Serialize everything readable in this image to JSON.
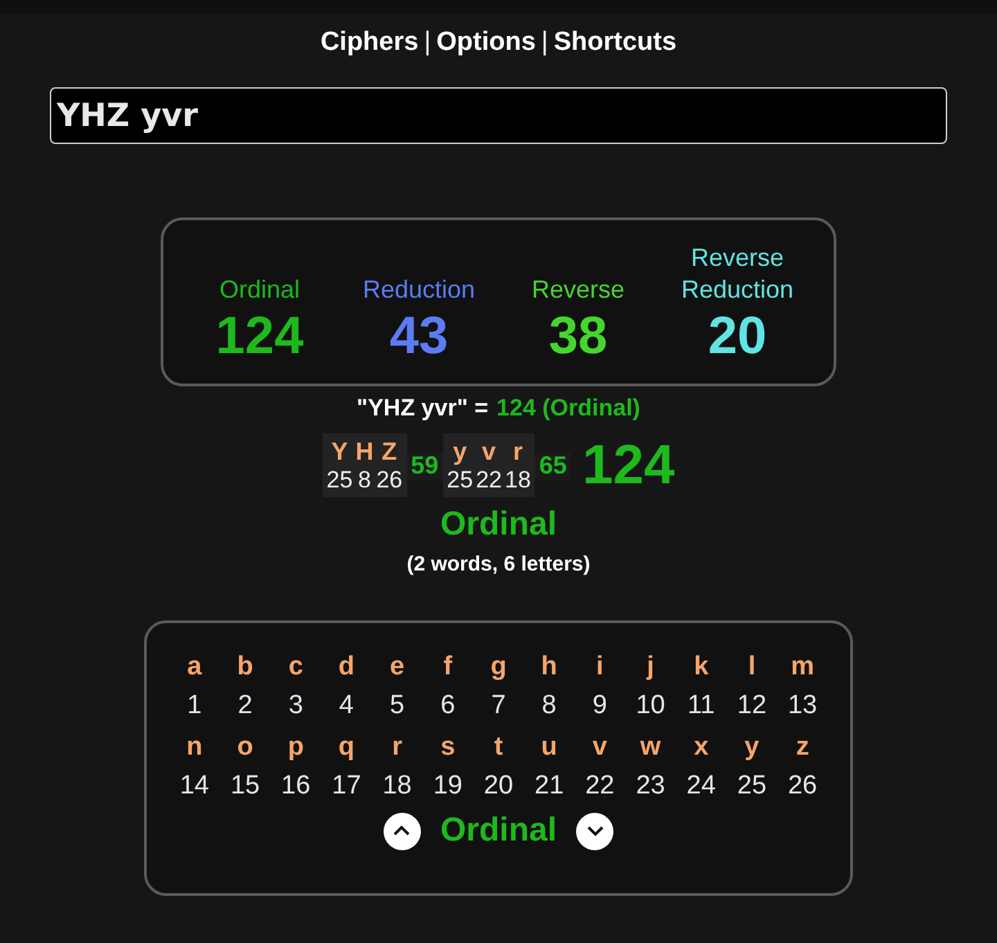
{
  "nav": {
    "links": [
      "Ciphers",
      "Options",
      "Shortcuts"
    ],
    "separators": [
      "|",
      "|"
    ]
  },
  "input": {
    "value": "YHZ yvr"
  },
  "ciphers": [
    {
      "name": "Ordinal",
      "value": "124",
      "color": "#1db91d"
    },
    {
      "name": "Reduction",
      "value": "43",
      "color": "#5b7cf2"
    },
    {
      "name": "Reverse",
      "value": "38",
      "color": "#45d62e"
    },
    {
      "name": "Reverse Reduction",
      "value": "20",
      "color": "#62e3e3"
    }
  ],
  "summary": {
    "phrase": "\"YHZ yvr\" =",
    "result": "124 (Ordinal)"
  },
  "breakdown": {
    "words": [
      {
        "letters": [
          {
            "ch": "Y",
            "val": "25"
          },
          {
            "ch": "H",
            "val": "8"
          },
          {
            "ch": "Z",
            "val": "26"
          }
        ],
        "total": "59"
      },
      {
        "letters": [
          {
            "ch": "y",
            "val": "25"
          },
          {
            "ch": "v",
            "val": "22"
          },
          {
            "ch": "r",
            "val": "18"
          }
        ],
        "total": "65"
      }
    ],
    "grand_total": "124",
    "cipher": "Ordinal",
    "counts": "(2 words, 6 letters)"
  },
  "chart": {
    "letters": [
      {
        "ch": "a",
        "val": "1"
      },
      {
        "ch": "b",
        "val": "2"
      },
      {
        "ch": "c",
        "val": "3"
      },
      {
        "ch": "d",
        "val": "4"
      },
      {
        "ch": "e",
        "val": "5"
      },
      {
        "ch": "f",
        "val": "6"
      },
      {
        "ch": "g",
        "val": "7"
      },
      {
        "ch": "h",
        "val": "8"
      },
      {
        "ch": "i",
        "val": "9"
      },
      {
        "ch": "j",
        "val": "10"
      },
      {
        "ch": "k",
        "val": "11"
      },
      {
        "ch": "l",
        "val": "12"
      },
      {
        "ch": "m",
        "val": "13"
      },
      {
        "ch": "n",
        "val": "14"
      },
      {
        "ch": "o",
        "val": "15"
      },
      {
        "ch": "p",
        "val": "16"
      },
      {
        "ch": "q",
        "val": "17"
      },
      {
        "ch": "r",
        "val": "18"
      },
      {
        "ch": "s",
        "val": "19"
      },
      {
        "ch": "t",
        "val": "20"
      },
      {
        "ch": "u",
        "val": "21"
      },
      {
        "ch": "v",
        "val": "22"
      },
      {
        "ch": "w",
        "val": "23"
      },
      {
        "ch": "x",
        "val": "24"
      },
      {
        "ch": "y",
        "val": "25"
      },
      {
        "ch": "z",
        "val": "26"
      }
    ],
    "cipher": "Ordinal"
  }
}
